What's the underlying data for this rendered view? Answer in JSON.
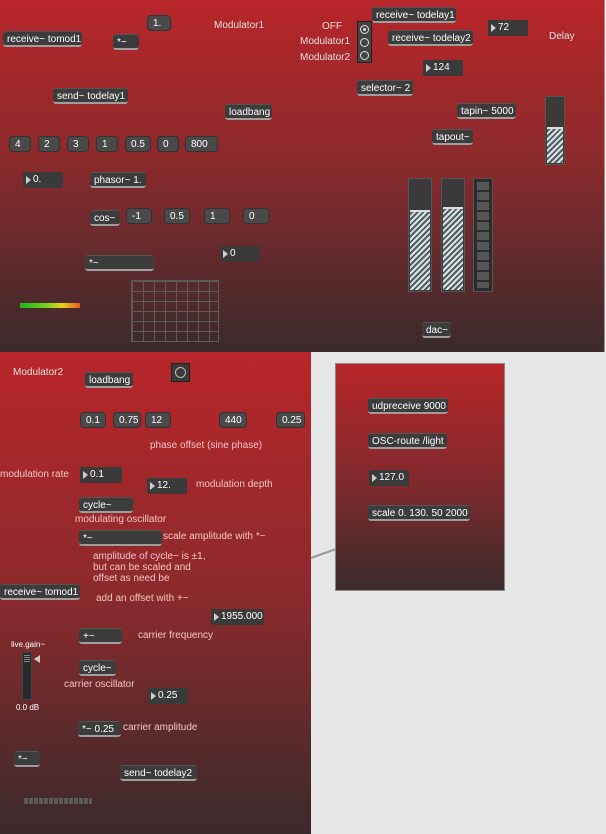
{
  "patch1": {
    "receive_tomod1": "receive~ tomod1",
    "times_sig": "*~",
    "msg_1": "1.",
    "title": "Modulator1",
    "radio_labels": [
      "OFF",
      "Modulator1",
      "Modulator2"
    ],
    "receive_todelay1": "receive~ todelay1",
    "receive_todelay2": "receive~ todelay2",
    "num_72": "72",
    "delay_label": "Delay",
    "num_124": "124",
    "send_todelay1": "send~ todelay1",
    "loadbang": "loadbang",
    "selector": "selector~ 2",
    "tapin": "tapin~ 5000",
    "tapout": "tapout~",
    "msgs": [
      "4",
      "2",
      "3",
      "1",
      "0.5",
      "0",
      "800"
    ],
    "num_0dot": "0.",
    "phasor": "phasor~ 1.",
    "cos": "cos~",
    "cos_msgs": [
      "-1",
      "0.5",
      "1",
      "0"
    ],
    "num_0": "0",
    "times2": "*~",
    "dac": "dac~"
  },
  "patch2": {
    "title": "Modulator2",
    "loadbang": "loadbang",
    "msgs": [
      "0.1",
      "0.75",
      "12",
      "440",
      "0.25"
    ],
    "phase_offset": "phase offset (sine phase)",
    "mod_rate_label": "modulation rate",
    "num_rate": "0.1",
    "num_depth": "12.",
    "mod_depth_label": "modulation depth",
    "cycle1": "cycle~",
    "mod_osc_label": "modulating oscillator",
    "times_sig": "*~",
    "scale_amp_label": "scale amplitude with *~",
    "note1": "amplitude of cycle~ is ±1,",
    "note2": "but can be scaled and",
    "note3": "offset as need be",
    "receive_tomod1": "receive~ tomod1",
    "add_offset_label": "add an offset with +~",
    "num_freq": "1955.000",
    "plus": "+~",
    "carrier_freq_label": "carrier frequency",
    "gain_label": "live.gain~",
    "gain_value": "0.0 dB",
    "cycle2": "cycle~",
    "carrier_osc_label": "carrier oscillator",
    "num_amp": "0.25",
    "times_amp": "*~ 0.25",
    "carrier_amp_label": "carrier amplitude",
    "times3": "*~",
    "send_todelay2": "send~ todelay2"
  },
  "patch3": {
    "udpreceive": "udpreceive 9000",
    "osc_route": "OSC-route /light",
    "num_127": "127.0",
    "scale": "scale 0. 130. 50 2000"
  }
}
